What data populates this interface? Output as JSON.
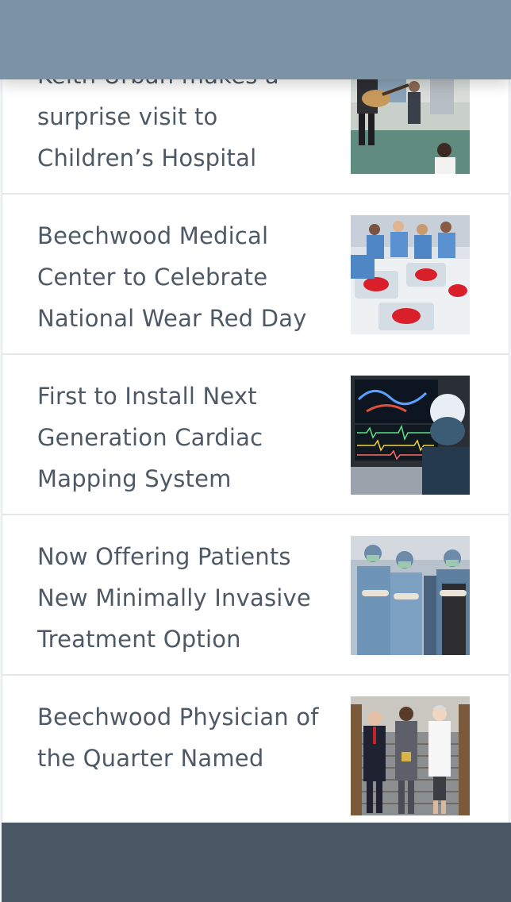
{
  "news": {
    "items": [
      {
        "title": "Keith Urban makes a surprise visit to Children’s Hospital",
        "image": "guitar-visit-photo"
      },
      {
        "title": "Beechwood Medical Center to Celebrate National Wear Red Day",
        "image": "newborns-red-photo"
      },
      {
        "title": "First to Install Next Generation Cardiac Mapping System",
        "image": "cardiac-lab-photo"
      },
      {
        "title": "Now Offering Patients New Minimally Invasive Treatment Option",
        "image": "surgical-team-photo"
      },
      {
        "title": "Beechwood Physician of the Quarter Named",
        "image": "award-photo"
      }
    ]
  },
  "colors": {
    "top_bar": "#7b93a5",
    "bottom_bar": "#4a5866",
    "title_text": "#4d5965"
  }
}
